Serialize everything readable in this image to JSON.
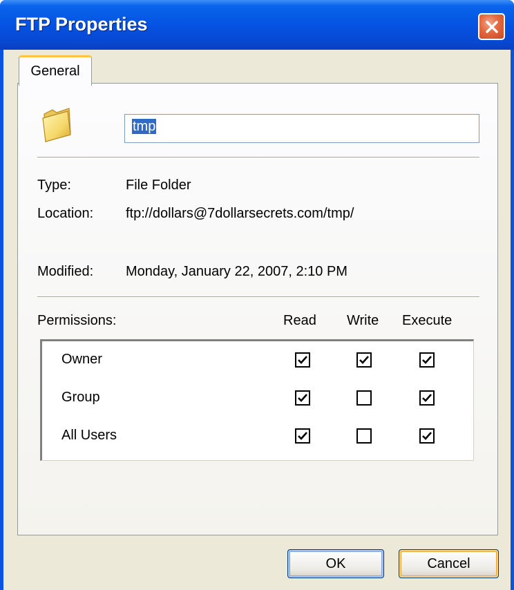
{
  "window": {
    "title": "FTP Properties"
  },
  "tabs": [
    {
      "label": "General",
      "active": true
    }
  ],
  "general": {
    "name_value": "tmp",
    "type_label": "Type:",
    "type_value": "File Folder",
    "location_label": "Location:",
    "location_value": "ftp://dollars@7dollarsecrets.com/tmp/",
    "modified_label": "Modified:",
    "modified_value": "Monday, January 22, 2007, 2:10 PM"
  },
  "permissions": {
    "label": "Permissions:",
    "columns": [
      "Read",
      "Write",
      "Execute"
    ],
    "rows": [
      {
        "name": "Owner",
        "read": true,
        "write": true,
        "execute": true
      },
      {
        "name": "Group",
        "read": true,
        "write": false,
        "execute": true
      },
      {
        "name": "All Users",
        "read": true,
        "write": false,
        "execute": true
      }
    ]
  },
  "buttons": {
    "ok_label": "OK",
    "cancel_label": "Cancel"
  },
  "icons": {
    "folder": "folder-icon",
    "close": "close-icon",
    "check": "check-icon"
  },
  "colors": {
    "titlebar": "#0553e2",
    "dialog_face": "#ece9d8",
    "close_button": "#e3673f",
    "selection": "#316ac5",
    "tab_highlight": "#ffc83c"
  }
}
